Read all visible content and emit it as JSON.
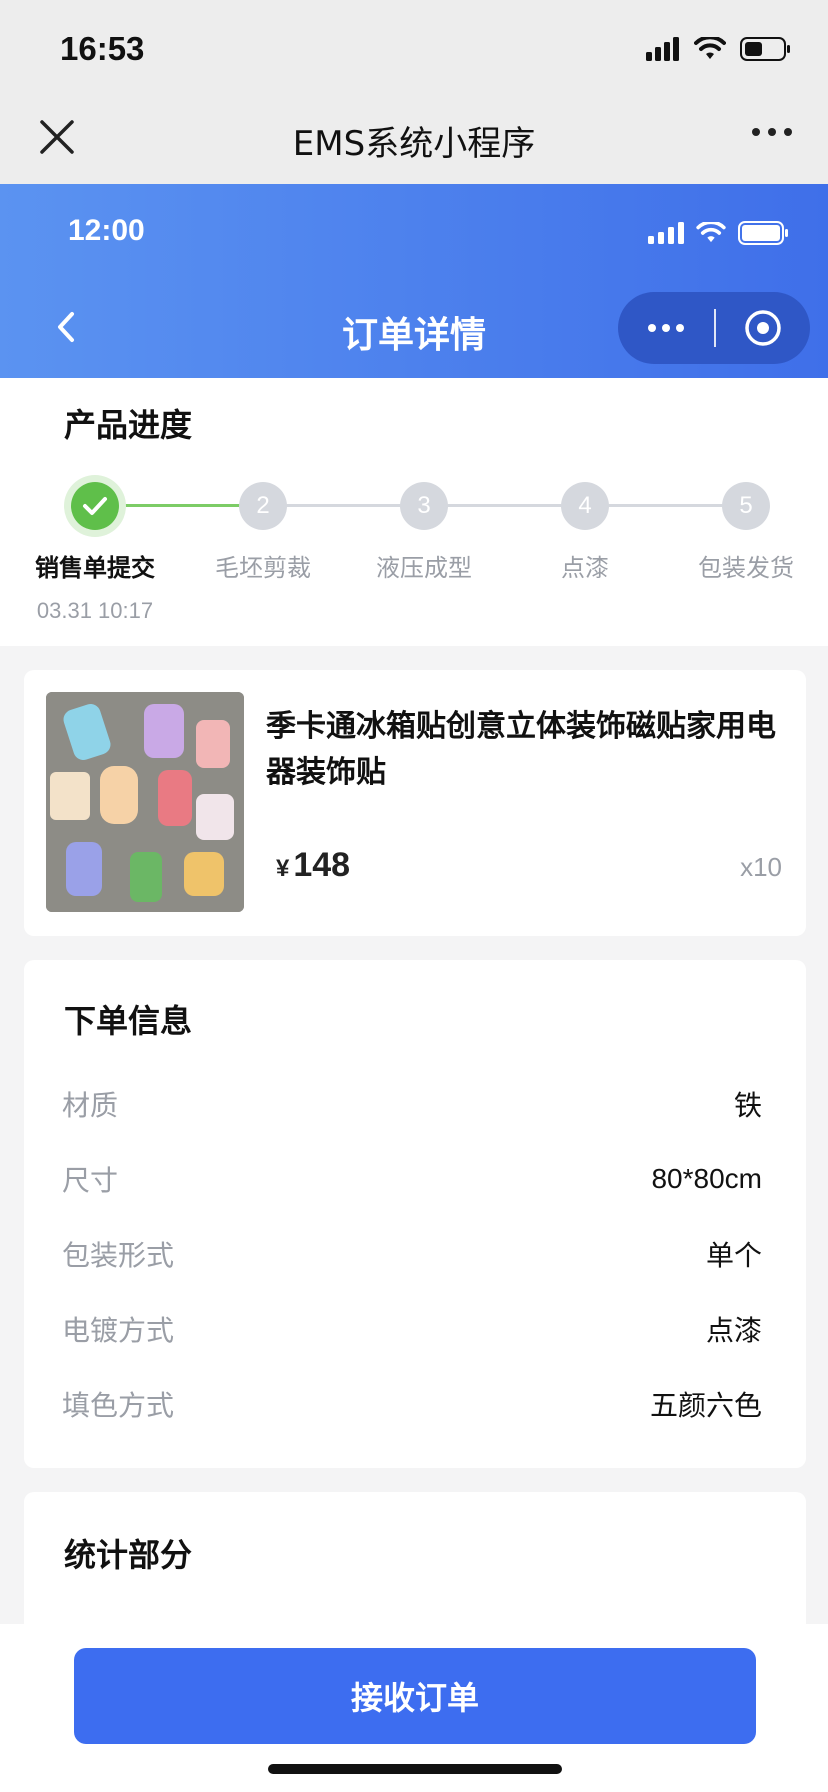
{
  "system": {
    "time": "16:53"
  },
  "outer_nav": {
    "title": "EMS系统小程序"
  },
  "inner_header": {
    "time": "12:00",
    "title": "订单详情"
  },
  "progress": {
    "title": "产品进度",
    "steps": [
      {
        "number": "",
        "label": "销售单提交",
        "date": "03.31 10:17",
        "status": "done"
      },
      {
        "number": "2",
        "label": "毛坯剪裁",
        "status": "pending"
      },
      {
        "number": "3",
        "label": "液压成型",
        "status": "pending"
      },
      {
        "number": "4",
        "label": "点漆",
        "status": "pending"
      },
      {
        "number": "5",
        "label": "包装发货",
        "status": "pending"
      }
    ]
  },
  "product": {
    "name": "季卡通冰箱贴创意立体装饰磁贴家用电器装饰贴",
    "currency": "¥",
    "price": "148",
    "quantity": "x10"
  },
  "order_info": {
    "title": "下单信息",
    "rows": [
      {
        "key": "材质",
        "value": "铁"
      },
      {
        "key": "尺寸",
        "value": "80*80cm"
      },
      {
        "key": "包装形式",
        "value": "单个"
      },
      {
        "key": "电镀方式",
        "value": "点漆"
      },
      {
        "key": "填色方式",
        "value": "五颜六色"
      }
    ]
  },
  "stats": {
    "title": "统计部分"
  },
  "actions": {
    "accept_label": "接收订单"
  },
  "colors": {
    "primary": "#3d6df0",
    "header_start": "#5b93f1",
    "header_end": "#3f6fe9",
    "success": "#5fbf4a",
    "muted": "#9a9ea6"
  }
}
